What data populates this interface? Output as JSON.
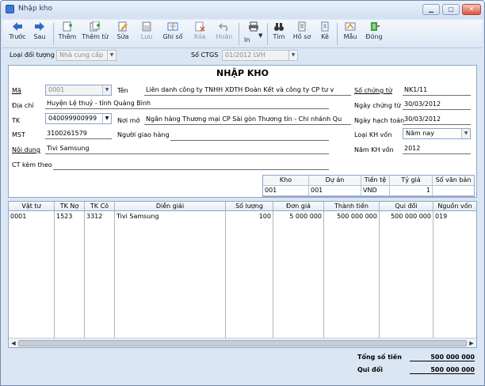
{
  "window": {
    "title": "Nhập kho",
    "min_icon": "minimize-icon",
    "max_icon": "maximize-icon",
    "close_icon": "close-icon"
  },
  "toolbar": [
    {
      "label": "Trước",
      "icon": "arrow-left-icon",
      "color": "#2b6cc4",
      "enabled": true
    },
    {
      "label": "Sau",
      "icon": "arrow-right-icon",
      "color": "#2b6cc4",
      "enabled": true
    },
    {
      "label": "Thêm",
      "icon": "add-document-icon",
      "color": "#3aa33a",
      "enabled": true
    },
    {
      "label": "Thêm từ",
      "icon": "add-from-icon",
      "color": "#3aa33a",
      "enabled": true
    },
    {
      "label": "Sửa",
      "icon": "edit-icon",
      "color": "#e8a23b",
      "enabled": true
    },
    {
      "label": "Lưu",
      "icon": "save-icon",
      "color": "#8a95a3",
      "enabled": false
    },
    {
      "label": "Ghi sổ",
      "icon": "post-ledger-icon",
      "color": "#3a7bd5",
      "enabled": true
    },
    {
      "label": "Xóa",
      "icon": "delete-icon",
      "color": "#8a95a3",
      "enabled": false
    },
    {
      "label": "Hoãn",
      "icon": "undo-icon",
      "color": "#8a95a3",
      "enabled": false
    },
    {
      "label": "In",
      "icon": "printer-icon",
      "color": "#444",
      "enabled": true
    },
    {
      "label": "Tìm",
      "icon": "binoculars-icon",
      "color": "#333",
      "enabled": true
    },
    {
      "label": "Hồ sơ",
      "icon": "profile-icon",
      "color": "#6a7d99",
      "enabled": true
    },
    {
      "label": "Kê",
      "icon": "list-icon",
      "color": "#6a7d99",
      "enabled": true
    },
    {
      "label": "Mẫu",
      "icon": "template-icon",
      "color": "#d98a2b",
      "enabled": true
    },
    {
      "label": "Đóng",
      "icon": "close-door-icon",
      "color": "#3aa33a",
      "enabled": true
    }
  ],
  "filter": {
    "type_label": "Loại đối tượng",
    "type_value": "Nhà cung cấp",
    "ctgs_label": "Số CTGS",
    "ctgs_value": "01/2012 LVH"
  },
  "form": {
    "title": "NHẬP KHO",
    "ma_label": "Mã",
    "ma_value": "0001",
    "ten_label": "Tên",
    "ten_value": "Liên  danh  công ty TNHH XDTH Đoàn Kết và công ty CP tư v",
    "diachi_label": "Địa chỉ",
    "diachi_value": "Huyện Lệ thuỷ - tỉnh Quảng Bình",
    "tk_label": "TK",
    "tk_value": "040099900999",
    "noimo_label": "Nơi mở",
    "noimo_value": "Ngân hàng Thương mại CP Sài gòn Thương tín - Chi nhánh Qu",
    "mst_label": "MST",
    "mst_value": "3100261579",
    "nguoigiao_label": "Người giao hàng",
    "nguoigiao_value": "",
    "noidung_label": "Nội dung",
    "noidung_value": "Tivi Samsung",
    "ctkem_label": "CT kèm theo",
    "ctkem_value": "",
    "sochungtu_label": "Số chứng từ",
    "sochungtu_value": "NK1/11",
    "ngaychungtu_label": "Ngày chứng từ",
    "ngaychungtu_value": "30/03/2012",
    "ngayhachtoan_label": "Ngày hạch toán",
    "ngayhachtoan_value": "30/03/2012",
    "loaikh_label": "Loại KH vốn",
    "loaikh_value": "Năm nay",
    "namkh_label": "Năm KH vốn",
    "namkh_value": "2012"
  },
  "mini_grid": {
    "headers": [
      "Kho",
      "Dự án",
      "Tiền tệ",
      "Tỷ giá",
      "Số văn bản"
    ],
    "row": [
      "001",
      "001",
      "VND",
      "1",
      ""
    ]
  },
  "detail": {
    "headers": [
      "Vật tư",
      "TK Nợ",
      "TK Có",
      "Diễn giải",
      "Số lượng",
      "Đơn giá",
      "Thành tiền",
      "Qui đổi",
      "Nguồn vốn"
    ],
    "rows": [
      [
        "0001",
        "1523",
        "3312",
        "Tivi Samsung",
        "100",
        "5 000 000",
        "500 000 000",
        "500 000 000",
        "019"
      ]
    ]
  },
  "totals": {
    "tong_label": "Tổng số tiền",
    "tong_value": "500 000 000",
    "quidoi_label": "Qui đổi",
    "quidoi_value": "500 000 000"
  }
}
